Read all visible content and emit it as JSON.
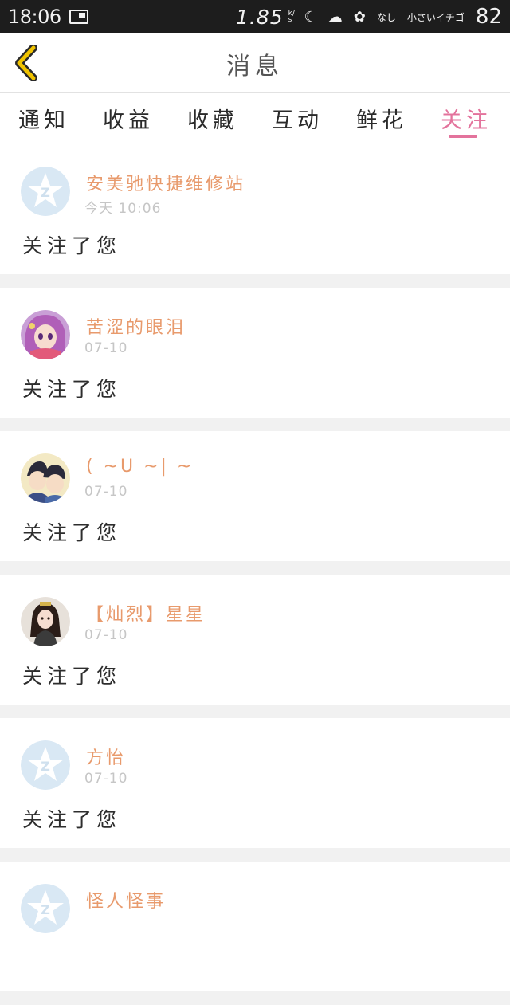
{
  "status_bar": {
    "time": "18:06",
    "net_speed": "1.85",
    "net_unit": "k/s",
    "carrier": "なし",
    "custom_text": "小さいイチゴ",
    "battery": "82",
    "icons": [
      "notification-icon",
      "moon-icon",
      "cloud-icon",
      "flower-icon"
    ]
  },
  "header": {
    "title": "消息",
    "back_icon": "chevron-left-icon"
  },
  "tabs": [
    {
      "label": "通知",
      "active": false
    },
    {
      "label": "收益",
      "active": false
    },
    {
      "label": "收藏",
      "active": false
    },
    {
      "label": "互动",
      "active": false
    },
    {
      "label": "鲜花",
      "active": false
    },
    {
      "label": "关注",
      "active": true
    }
  ],
  "messages": [
    {
      "name": "安美驰快捷维修站",
      "time": "今天 10:06",
      "text": "关注了您",
      "avatar": "default-qq-avatar"
    },
    {
      "name": "苦涩的眼泪",
      "time": "07-10",
      "text": "关注了您",
      "avatar": "anime-girl-avatar"
    },
    {
      "name": "( ~U ~| ~",
      "time": "07-10",
      "text": "关注了您",
      "avatar": "anime-boys-avatar"
    },
    {
      "name": "【灿烈】星星",
      "time": "07-10",
      "text": "关注了您",
      "avatar": "doll-girl-avatar"
    },
    {
      "name": "方怡",
      "time": "07-10",
      "text": "关注了您",
      "avatar": "default-qq-avatar"
    },
    {
      "name": "怪人怪事",
      "time": "",
      "text": "",
      "avatar": "default-qq-avatar"
    }
  ],
  "colors": {
    "accent": "#e3739c",
    "name": "#e89a6c",
    "back": "#f0c300"
  }
}
